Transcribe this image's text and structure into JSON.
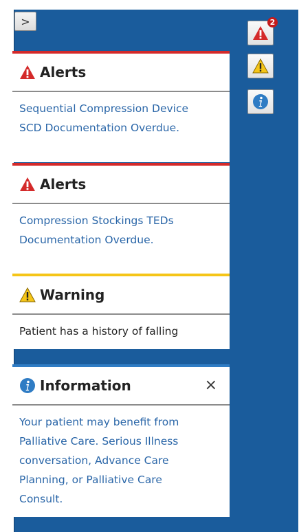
{
  "colors": {
    "panel_bg": "#1a5c9c",
    "alert_red": "#d42a2a",
    "warning_yellow": "#f5c518",
    "info_blue": "#2f7cc4",
    "link_text": "#2a66a8"
  },
  "collapse_button": {
    "icon": "chevron-right-icon",
    "glyph": ">"
  },
  "cards": [
    {
      "type": "alert",
      "icon": "alert-red-triangle-icon",
      "title": "Alerts",
      "body": "Sequential Compression Device\nSCD Documentation Overdue."
    },
    {
      "type": "alert",
      "icon": "alert-red-triangle-icon",
      "title": "Alerts",
      "body": "Compression Stockings TEDs\nDocumentation Overdue."
    },
    {
      "type": "warning",
      "icon": "warning-yellow-triangle-icon",
      "title": "Warning",
      "body": "Patient has a history of falling"
    },
    {
      "type": "information",
      "icon": "info-circle-icon",
      "title": "Information",
      "close_glyph": "×",
      "body": "Your patient may benefit from\nPalliative Care. Serious Illness\nconversation, Advance Care\nPlanning, or Palliative Care\nConsult."
    }
  ],
  "side_buttons": [
    {
      "icon": "alert-red-triangle-icon",
      "badge": "2"
    },
    {
      "icon": "warning-yellow-triangle-icon"
    },
    {
      "icon": "info-circle-icon"
    }
  ]
}
